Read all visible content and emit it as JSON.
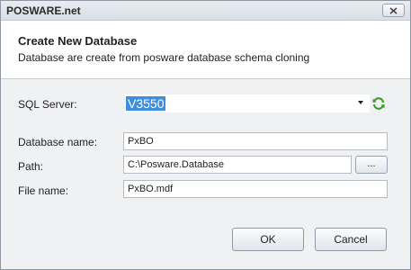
{
  "window": {
    "title": "POSWARE.net",
    "close_label": "x"
  },
  "header": {
    "title": "Create New Database",
    "subtitle": "Database are create from posware database schema cloning"
  },
  "form": {
    "sql_server": {
      "label": "SQL Server:",
      "value": "V3550"
    },
    "database_name": {
      "label": "Database name:",
      "value": "PxBO"
    },
    "path": {
      "label": "Path:",
      "value": "C:\\Posware.Database",
      "browse_label": "..."
    },
    "file_name": {
      "label": "File name:",
      "value": "PxBO.mdf"
    }
  },
  "buttons": {
    "ok": "OK",
    "cancel": "Cancel"
  },
  "icons": {
    "close": "close-icon",
    "dropdown": "chevron-down-icon",
    "refresh": "refresh-icon"
  },
  "colors": {
    "selection": "#3d8ede",
    "refresh_green": "#3a9b2c"
  }
}
